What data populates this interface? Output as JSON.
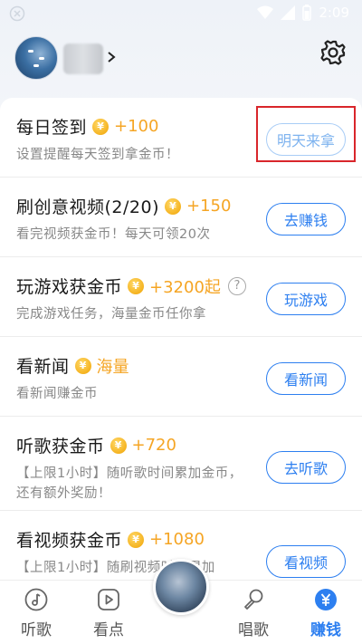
{
  "status_bar": {
    "time": "2:09",
    "left_icon": "close-circle-icon",
    "wifi_icon": "wifi-icon",
    "battery_icon": "battery-icon"
  },
  "header": {
    "avatar_icon": "avatar",
    "chevron_icon": "chevron-right-icon",
    "settings_icon": "gear-icon"
  },
  "tasks": [
    {
      "title": "每日签到",
      "reward": "+100",
      "desc": "设置提醒每天签到拿金币！",
      "button": "明天来拿",
      "button_state": "disabled"
    },
    {
      "title": "刷创意视频(2/20)",
      "reward": "+150",
      "desc": "看完视频获金币！每天可领20次",
      "button": "去赚钱"
    },
    {
      "title": "玩游戏获金币",
      "reward": "+3200起",
      "desc": "完成游戏任务，海量金币任你拿",
      "button": "玩游戏"
    },
    {
      "title": "看新闻",
      "reward": "海量",
      "desc": "看新闻赚金币",
      "button": "看新闻"
    },
    {
      "title": "听歌获金币",
      "reward": "+720",
      "desc": "【上限1小时】随听歌时间累加金币，还有额外奖励！",
      "button": "去听歌"
    },
    {
      "title": "看视频获金币",
      "reward": "+1080",
      "desc": "【上限1小时】随刷视频时间累加",
      "button": "看视频"
    }
  ],
  "coin_symbol": "¥",
  "help_symbol": "?",
  "bottom_nav": {
    "items": [
      {
        "label": "听歌",
        "icon": "music-note-icon"
      },
      {
        "label": "看点",
        "icon": "play-icon"
      },
      {
        "label": "唱歌",
        "icon": "microphone-icon"
      },
      {
        "label": "赚钱",
        "icon": "yuan-icon",
        "active": true
      }
    ]
  },
  "colors": {
    "accent": "#2d7ff0",
    "reward": "#f5a524",
    "highlight_box": "#d9262b"
  }
}
